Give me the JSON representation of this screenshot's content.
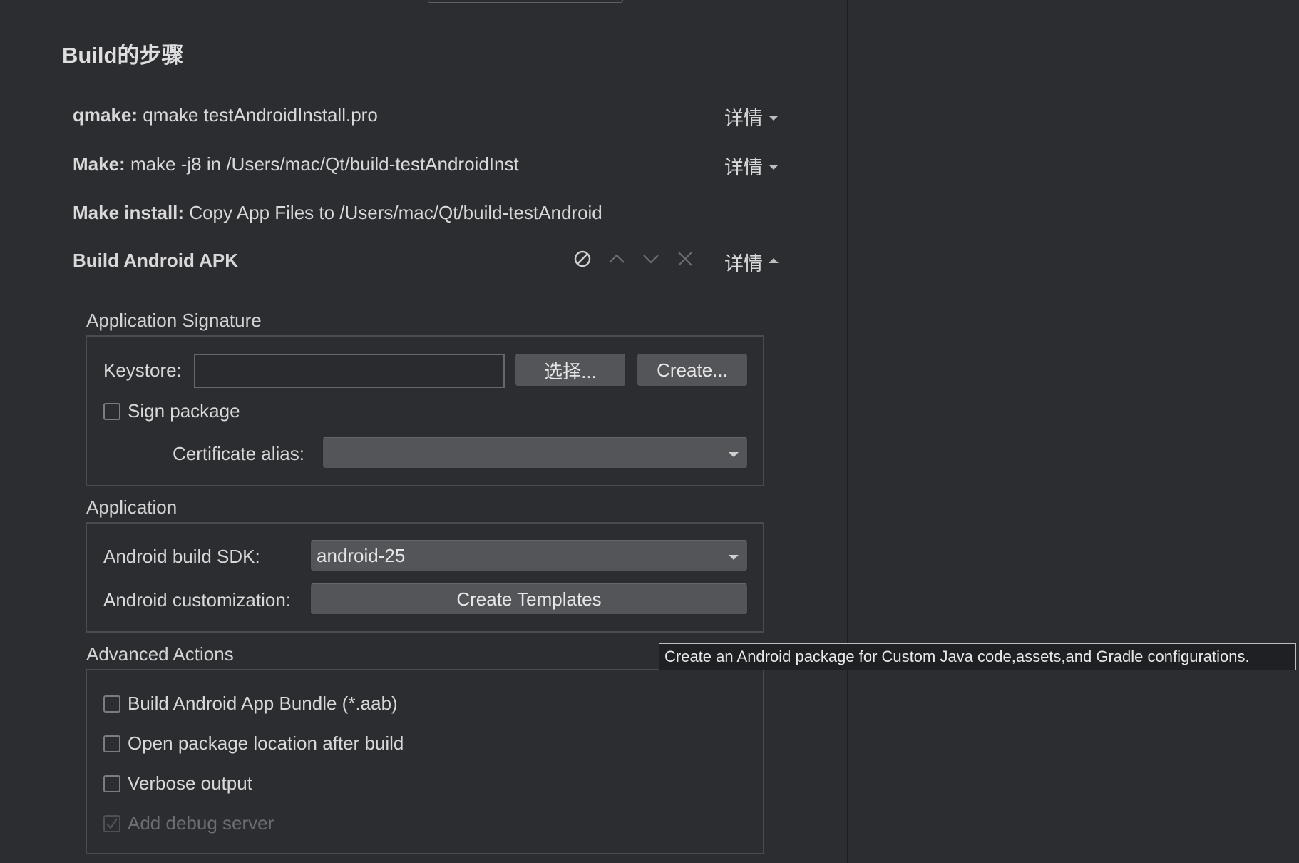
{
  "section": {
    "title": "Build的步骤"
  },
  "steps": [
    {
      "name": "qmake:",
      "text": "qmake testAndroidInstall.pro",
      "details": "详情"
    },
    {
      "name": "Make:",
      "text": "make -j8 in /Users/mac/Qt/build-testAndroidInst",
      "details": "详情"
    },
    {
      "name": "Make install:",
      "text": "Copy App Files to /Users/mac/Qt/build-testAndroid"
    },
    {
      "name": "Build Android APK",
      "text": "",
      "details": "详情"
    }
  ],
  "signature": {
    "group_label": "Application Signature",
    "keystore_label": "Keystore:",
    "keystore_value": "",
    "choose_label": "选择...",
    "create_label": "Create...",
    "sign_package_label": "Sign package",
    "sign_package_checked": false,
    "cert_alias_label": "Certificate alias:",
    "cert_alias_value": ""
  },
  "application": {
    "group_label": "Application",
    "sdk_label": "Android build SDK:",
    "sdk_value": "android-25",
    "customization_label": "Android customization:",
    "templates_label": "Create Templates"
  },
  "advanced": {
    "group_label": "Advanced Actions",
    "options": [
      {
        "label": "Build Android App Bundle (*.aab)",
        "checked": false,
        "enabled": true
      },
      {
        "label": "Open package location after build",
        "checked": false,
        "enabled": true
      },
      {
        "label": "Verbose output",
        "checked": false,
        "enabled": true
      },
      {
        "label": "Add debug server",
        "checked": true,
        "enabled": false
      }
    ]
  },
  "tooltip": {
    "text": "Create an Android package for Custom Java code,assets,and Gradle configurations."
  },
  "colors": {
    "background": "#2c2d31",
    "button": "#545559",
    "border": "#4a4b4f",
    "tooltip_bg": "#1f2023"
  }
}
